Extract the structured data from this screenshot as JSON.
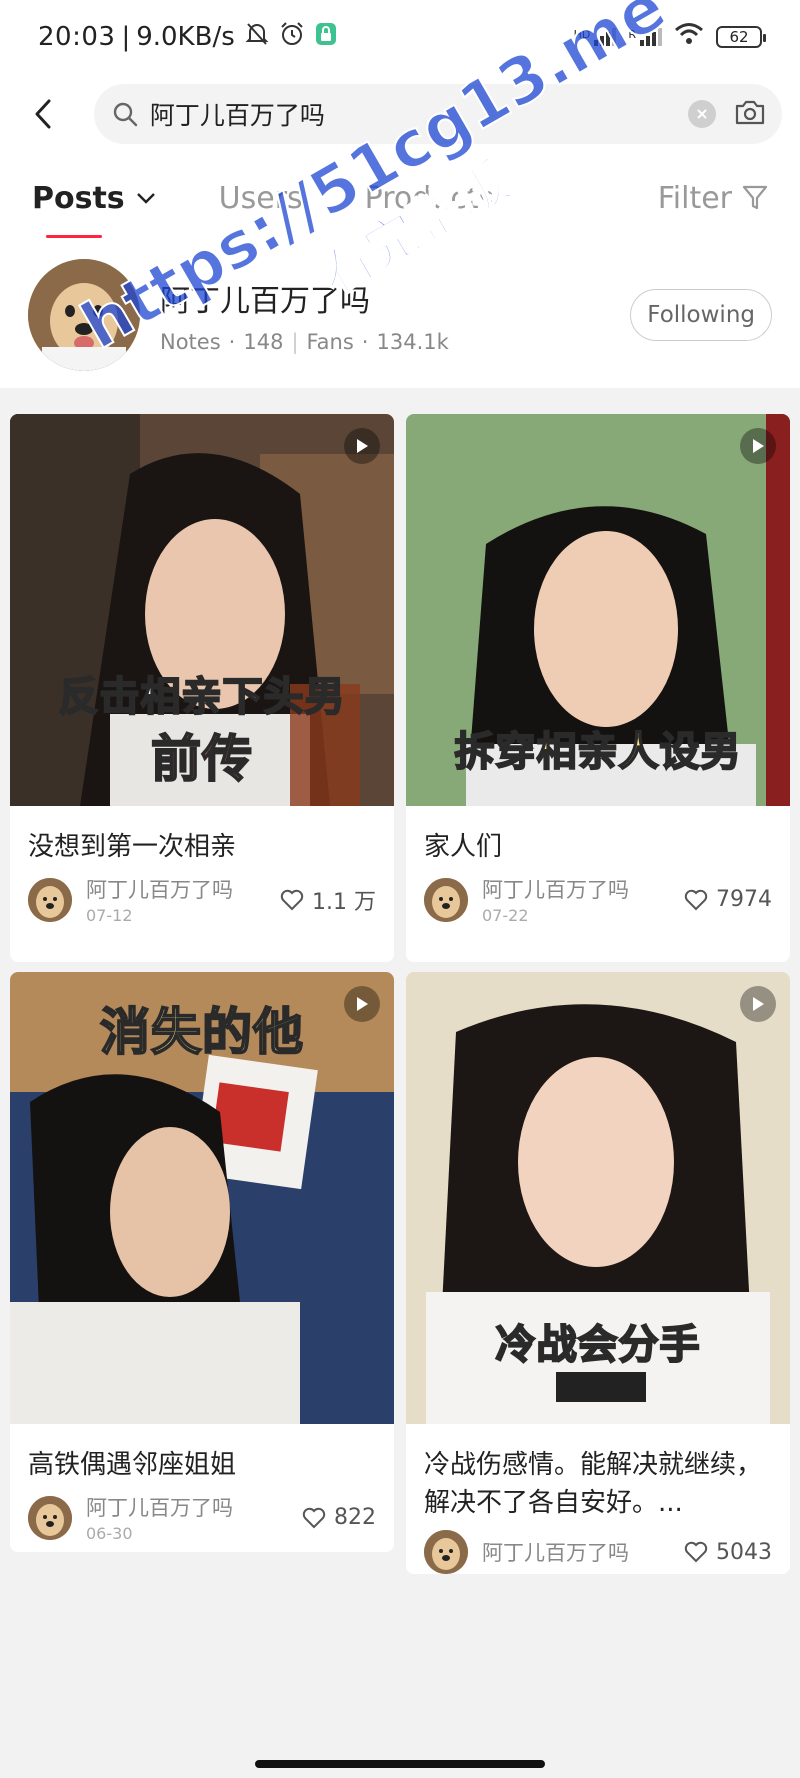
{
  "status": {
    "time": "20:03",
    "speed": "9.0KB/s",
    "net1": "HD",
    "net2": "R",
    "battery": "62"
  },
  "search": {
    "query": "阿丁儿百万了吗"
  },
  "tabs": [
    {
      "label": "Posts",
      "active": true
    },
    {
      "label": "Users",
      "active": false
    },
    {
      "label": "Products",
      "active": false
    }
  ],
  "filter_label": "Filter",
  "profile": {
    "name": "阿丁儿百万了吗",
    "notes_label": "Notes",
    "notes": "148",
    "fans_label": "Fans",
    "fans": "134.1k",
    "follow_label": "Following"
  },
  "posts": [
    {
      "caption1": "反击相亲下头男",
      "caption2": "前传",
      "title": "没想到第一次相亲",
      "author": "阿丁儿百万了吗",
      "date": "07-12",
      "likes": "1.1 万"
    },
    {
      "caption1": "拆穿相亲人设男",
      "title": "家人们",
      "author": "阿丁儿百万了吗",
      "date": "07-22",
      "likes": "7974"
    },
    {
      "caption1": "消失的他",
      "title": "高铁偶遇邻座姐姐",
      "author": "阿丁儿百万了吗",
      "date": "06-30",
      "likes": "822"
    },
    {
      "caption1": "冷战会分手",
      "title": "冷战伤感情。能解决就继续，解决不了各自安好。...",
      "author": "阿丁儿百万了吗",
      "likes": "5043"
    }
  ],
  "watermark": {
    "line1": "https://51cg13.me",
    "line2": "看完整版"
  },
  "colors": {
    "accent": "#ff2442",
    "watermark": "#1e46d2"
  }
}
